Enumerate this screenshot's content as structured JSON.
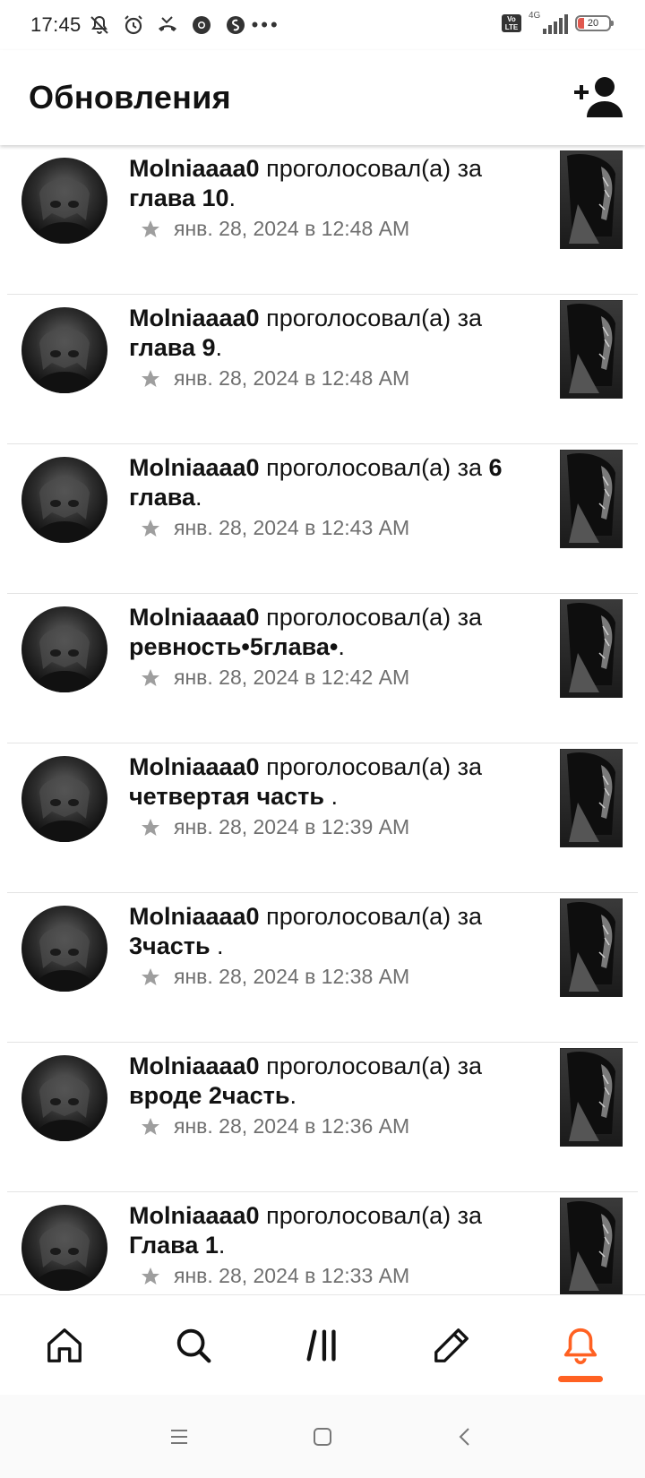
{
  "status_bar": {
    "time": "17:45",
    "network": "4G",
    "volte": "Vo LTE",
    "battery": "20"
  },
  "header": {
    "title": "Обновления",
    "add_friend_icon": "person-add-icon"
  },
  "feed": {
    "items": [
      {
        "user": "Molniaaaa0",
        "action": "проголосовал(а) за",
        "story": "глава 10",
        "time": "янв. 28, 2024 в 12:48 AM"
      },
      {
        "user": "Molniaaaa0",
        "action": "проголосовал(а) за",
        "story": "глава 9",
        "time": "янв. 28, 2024 в 12:48 AM"
      },
      {
        "user": "Molniaaaa0",
        "action": "проголосовал(а) за",
        "story": "6 глава",
        "time": "янв. 28, 2024 в 12:43 AM"
      },
      {
        "user": "Molniaaaa0",
        "action": "проголосовал(а) за",
        "story": "ревность•5глава•",
        "time": "янв. 28, 2024 в 12:42 AM"
      },
      {
        "user": "Molniaaaa0",
        "action": "проголосовал(а) за",
        "story": "четвертая часть ",
        "time": "янв. 28, 2024 в 12:39 AM"
      },
      {
        "user": "Molniaaaa0",
        "action": "проголосовал(а) за",
        "story": "3часть ",
        "time": "янв. 28, 2024 в 12:38 AM"
      },
      {
        "user": "Molniaaaa0",
        "action": "проголосовал(а) за",
        "story": "вроде 2часть",
        "time": "янв. 28, 2024 в 12:36 AM"
      },
      {
        "user": "Molniaaaa0",
        "action": "проголосовал(а) за",
        "story": "Глава 1",
        "time": "янв. 28, 2024 в 12:33 AM"
      }
    ]
  },
  "bottom_nav": {
    "items": [
      "home-icon",
      "search-icon",
      "library-icon",
      "write-icon",
      "notifications-icon"
    ],
    "active": "notifications-icon",
    "accent": "#ff6122"
  },
  "system_nav": [
    "menu-icon",
    "home-square-icon",
    "back-icon"
  ]
}
